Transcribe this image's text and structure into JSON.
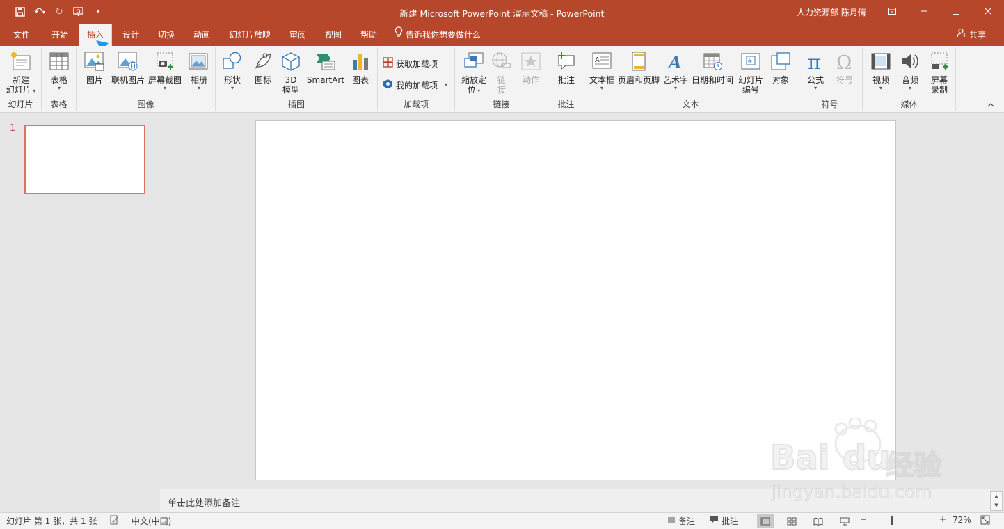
{
  "window": {
    "title": "新建 Microsoft PowerPoint 演示文稿 - PowerPoint",
    "user": "人力资源部 陈月倩"
  },
  "tabs": [
    {
      "label": "文件"
    },
    {
      "label": "开始"
    },
    {
      "label": "插入"
    },
    {
      "label": "设计"
    },
    {
      "label": "切换"
    },
    {
      "label": "动画"
    },
    {
      "label": "幻灯片放映"
    },
    {
      "label": "审阅"
    },
    {
      "label": "视图"
    },
    {
      "label": "帮助"
    }
  ],
  "active_tab": "插入",
  "tellme": "告诉我你想要做什么",
  "share": "共享",
  "ribbon": {
    "groups": {
      "slides": "幻灯片",
      "tables": "表格",
      "images": "图像",
      "illustrations": "插图",
      "addins": "加载项",
      "links": "链接",
      "comments": "批注",
      "text": "文本",
      "symbols": "符号",
      "media": "媒体"
    },
    "buttons": {
      "new_slide_1": "新建",
      "new_slide_2": "幻灯片",
      "table": "表格",
      "picture": "图片",
      "online_picture": "联机图片",
      "screenshot": "屏幕截图",
      "album": "相册",
      "shapes": "形状",
      "icons": "图标",
      "model3d_1": "3D",
      "model3d_2": "模型",
      "smartart": "SmartArt",
      "chart": "图表",
      "get_addins": "获取加载项",
      "my_addins": "我的加载项",
      "zoom_1": "缩放定",
      "zoom_2": "位",
      "link_1": "链",
      "link_2": "接",
      "action": "动作",
      "comment": "批注",
      "textbox": "文本框",
      "header_footer": "页眉和页脚",
      "wordart": "艺术字",
      "datetime": "日期和时间",
      "slide_number_1": "幻灯片",
      "slide_number_2": "编号",
      "object": "对象",
      "equation": "公式",
      "symbol": "符号",
      "video": "视频",
      "audio": "音频",
      "screen_rec_1": "屏幕",
      "screen_rec_2": "录制"
    }
  },
  "thumbnails": {
    "number": "1"
  },
  "notes_placeholder": "单击此处添加备注",
  "status": {
    "slide_info": "幻灯片 第 1 张，共 1 张",
    "language": "中文(中国)",
    "notes": "备注",
    "comments": "批注",
    "zoom": "72%"
  },
  "watermark": {
    "brand_1": "Bai",
    "brand_2": "du",
    "brand_cn": "经验",
    "url": "jingyan.baidu.com"
  },
  "colors": {
    "accent": "#b7472a",
    "ribbon_bg": "#f3f3f3",
    "thumb_border": "#e0735b",
    "annotation_arrow": "#2196f3"
  }
}
